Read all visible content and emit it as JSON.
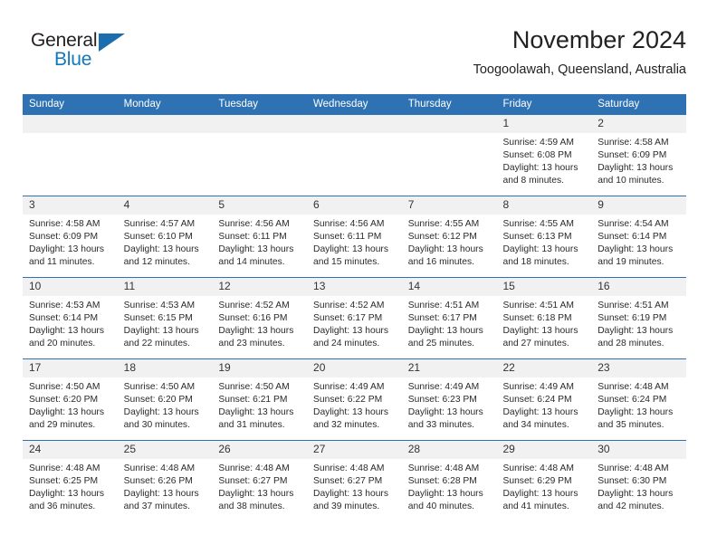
{
  "brand": {
    "name_top": "General",
    "name_bottom": "Blue",
    "color_dark": "#231f20",
    "color_blue": "#1278be",
    "triangle_color": "#1a6eb0"
  },
  "header": {
    "title": "November 2024",
    "subtitle": "Toogoolawah, Queensland, Australia"
  },
  "theme": {
    "header_blue": "#2e72b3",
    "daynum_band": "#f1f1f1",
    "text": "#222222"
  },
  "calendar": {
    "weekdays": [
      "Sunday",
      "Monday",
      "Tuesday",
      "Wednesday",
      "Thursday",
      "Friday",
      "Saturday"
    ],
    "weeks": [
      [
        {
          "day": "",
          "lines": []
        },
        {
          "day": "",
          "lines": []
        },
        {
          "day": "",
          "lines": []
        },
        {
          "day": "",
          "lines": []
        },
        {
          "day": "",
          "lines": []
        },
        {
          "day": "1",
          "lines": [
            "Sunrise: 4:59 AM",
            "Sunset: 6:08 PM",
            "Daylight: 13 hours",
            "and 8 minutes."
          ]
        },
        {
          "day": "2",
          "lines": [
            "Sunrise: 4:58 AM",
            "Sunset: 6:09 PM",
            "Daylight: 13 hours",
            "and 10 minutes."
          ]
        }
      ],
      [
        {
          "day": "3",
          "lines": [
            "Sunrise: 4:58 AM",
            "Sunset: 6:09 PM",
            "Daylight: 13 hours",
            "and 11 minutes."
          ]
        },
        {
          "day": "4",
          "lines": [
            "Sunrise: 4:57 AM",
            "Sunset: 6:10 PM",
            "Daylight: 13 hours",
            "and 12 minutes."
          ]
        },
        {
          "day": "5",
          "lines": [
            "Sunrise: 4:56 AM",
            "Sunset: 6:11 PM",
            "Daylight: 13 hours",
            "and 14 minutes."
          ]
        },
        {
          "day": "6",
          "lines": [
            "Sunrise: 4:56 AM",
            "Sunset: 6:11 PM",
            "Daylight: 13 hours",
            "and 15 minutes."
          ]
        },
        {
          "day": "7",
          "lines": [
            "Sunrise: 4:55 AM",
            "Sunset: 6:12 PM",
            "Daylight: 13 hours",
            "and 16 minutes."
          ]
        },
        {
          "day": "8",
          "lines": [
            "Sunrise: 4:55 AM",
            "Sunset: 6:13 PM",
            "Daylight: 13 hours",
            "and 18 minutes."
          ]
        },
        {
          "day": "9",
          "lines": [
            "Sunrise: 4:54 AM",
            "Sunset: 6:14 PM",
            "Daylight: 13 hours",
            "and 19 minutes."
          ]
        }
      ],
      [
        {
          "day": "10",
          "lines": [
            "Sunrise: 4:53 AM",
            "Sunset: 6:14 PM",
            "Daylight: 13 hours",
            "and 20 minutes."
          ]
        },
        {
          "day": "11",
          "lines": [
            "Sunrise: 4:53 AM",
            "Sunset: 6:15 PM",
            "Daylight: 13 hours",
            "and 22 minutes."
          ]
        },
        {
          "day": "12",
          "lines": [
            "Sunrise: 4:52 AM",
            "Sunset: 6:16 PM",
            "Daylight: 13 hours",
            "and 23 minutes."
          ]
        },
        {
          "day": "13",
          "lines": [
            "Sunrise: 4:52 AM",
            "Sunset: 6:17 PM",
            "Daylight: 13 hours",
            "and 24 minutes."
          ]
        },
        {
          "day": "14",
          "lines": [
            "Sunrise: 4:51 AM",
            "Sunset: 6:17 PM",
            "Daylight: 13 hours",
            "and 25 minutes."
          ]
        },
        {
          "day": "15",
          "lines": [
            "Sunrise: 4:51 AM",
            "Sunset: 6:18 PM",
            "Daylight: 13 hours",
            "and 27 minutes."
          ]
        },
        {
          "day": "16",
          "lines": [
            "Sunrise: 4:51 AM",
            "Sunset: 6:19 PM",
            "Daylight: 13 hours",
            "and 28 minutes."
          ]
        }
      ],
      [
        {
          "day": "17",
          "lines": [
            "Sunrise: 4:50 AM",
            "Sunset: 6:20 PM",
            "Daylight: 13 hours",
            "and 29 minutes."
          ]
        },
        {
          "day": "18",
          "lines": [
            "Sunrise: 4:50 AM",
            "Sunset: 6:20 PM",
            "Daylight: 13 hours",
            "and 30 minutes."
          ]
        },
        {
          "day": "19",
          "lines": [
            "Sunrise: 4:50 AM",
            "Sunset: 6:21 PM",
            "Daylight: 13 hours",
            "and 31 minutes."
          ]
        },
        {
          "day": "20",
          "lines": [
            "Sunrise: 4:49 AM",
            "Sunset: 6:22 PM",
            "Daylight: 13 hours",
            "and 32 minutes."
          ]
        },
        {
          "day": "21",
          "lines": [
            "Sunrise: 4:49 AM",
            "Sunset: 6:23 PM",
            "Daylight: 13 hours",
            "and 33 minutes."
          ]
        },
        {
          "day": "22",
          "lines": [
            "Sunrise: 4:49 AM",
            "Sunset: 6:24 PM",
            "Daylight: 13 hours",
            "and 34 minutes."
          ]
        },
        {
          "day": "23",
          "lines": [
            "Sunrise: 4:48 AM",
            "Sunset: 6:24 PM",
            "Daylight: 13 hours",
            "and 35 minutes."
          ]
        }
      ],
      [
        {
          "day": "24",
          "lines": [
            "Sunrise: 4:48 AM",
            "Sunset: 6:25 PM",
            "Daylight: 13 hours",
            "and 36 minutes."
          ]
        },
        {
          "day": "25",
          "lines": [
            "Sunrise: 4:48 AM",
            "Sunset: 6:26 PM",
            "Daylight: 13 hours",
            "and 37 minutes."
          ]
        },
        {
          "day": "26",
          "lines": [
            "Sunrise: 4:48 AM",
            "Sunset: 6:27 PM",
            "Daylight: 13 hours",
            "and 38 minutes."
          ]
        },
        {
          "day": "27",
          "lines": [
            "Sunrise: 4:48 AM",
            "Sunset: 6:27 PM",
            "Daylight: 13 hours",
            "and 39 minutes."
          ]
        },
        {
          "day": "28",
          "lines": [
            "Sunrise: 4:48 AM",
            "Sunset: 6:28 PM",
            "Daylight: 13 hours",
            "and 40 minutes."
          ]
        },
        {
          "day": "29",
          "lines": [
            "Sunrise: 4:48 AM",
            "Sunset: 6:29 PM",
            "Daylight: 13 hours",
            "and 41 minutes."
          ]
        },
        {
          "day": "30",
          "lines": [
            "Sunrise: 4:48 AM",
            "Sunset: 6:30 PM",
            "Daylight: 13 hours",
            "and 42 minutes."
          ]
        }
      ]
    ]
  }
}
